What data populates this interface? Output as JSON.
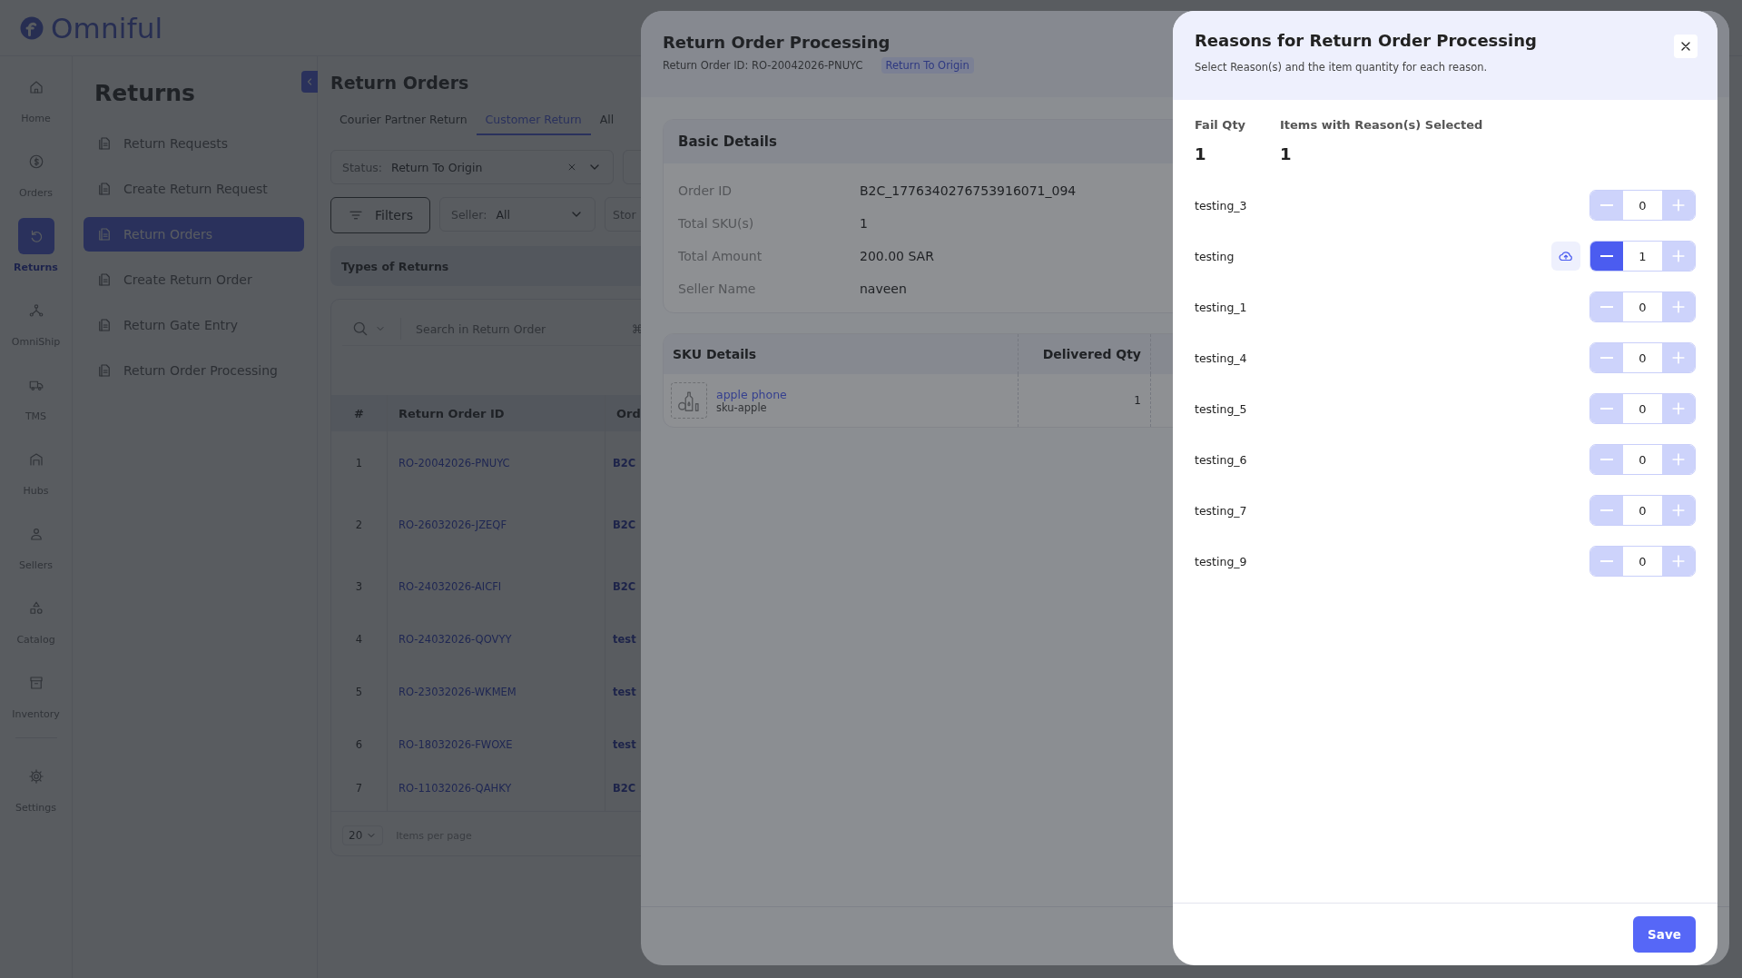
{
  "logo": {
    "text": "Omniful"
  },
  "nav": {
    "items": [
      {
        "label": "Home",
        "selected": false
      },
      {
        "label": "Orders",
        "selected": false
      },
      {
        "label": "Returns",
        "selected": true
      },
      {
        "label": "OmniShip",
        "selected": false
      },
      {
        "label": "TMS",
        "selected": false
      },
      {
        "label": "Hubs",
        "selected": false
      },
      {
        "label": "Sellers",
        "selected": false
      },
      {
        "label": "Catalog",
        "selected": false
      },
      {
        "label": "Inventory",
        "selected": false
      }
    ],
    "footer_items": [
      {
        "label": "Settings",
        "selected": false
      }
    ]
  },
  "section_menu": {
    "title": "Returns",
    "items": [
      {
        "label": "Return Requests",
        "selected": false
      },
      {
        "label": "Create Return Request",
        "selected": false
      },
      {
        "label": "Return Orders",
        "selected": true
      },
      {
        "label": "Create Return Order",
        "selected": false
      },
      {
        "label": "Return Gate Entry",
        "selected": false
      },
      {
        "label": "Return Order Processing",
        "selected": false
      }
    ]
  },
  "orders_list": {
    "title": "Return Orders",
    "tabs": [
      {
        "label": "Courier Partner Return",
        "selected": false
      },
      {
        "label": "Customer Return",
        "selected": true
      },
      {
        "label": "All",
        "selected": false
      }
    ],
    "status_filter": {
      "label": "Status:",
      "value": "Return To Origin"
    },
    "filters_button": "Filters",
    "seller_filter": {
      "label": "Seller:",
      "value": "All"
    },
    "store_filter": {
      "label": "Stor"
    },
    "types_heading": "Types of Returns",
    "search": {
      "placeholder": "Search in Return Order",
      "shortcut": "⌘"
    },
    "table": {
      "columns": [
        "#",
        "Return Order ID",
        "Ord"
      ],
      "rows": [
        {
          "number": "1",
          "return_order_id": "RO-20042026-PNUYC",
          "column_3": "B2C"
        },
        {
          "number": "2",
          "return_order_id": "RO-26032026-JZEQF",
          "column_3": "B2C"
        },
        {
          "number": "3",
          "return_order_id": "RO-24032026-AICFI",
          "column_3": "B2C"
        },
        {
          "number": "4",
          "return_order_id": "RO-24032026-QOVYY",
          "column_3": "test"
        },
        {
          "number": "5",
          "return_order_id": "RO-23032026-WKMEM",
          "column_3": "test"
        },
        {
          "number": "6",
          "return_order_id": "RO-18032026-FWOXE",
          "column_3": "test"
        },
        {
          "number": "7",
          "return_order_id": "RO-11032026-QAHKY",
          "column_3": "B2C"
        }
      ]
    },
    "pagination": {
      "per_page": "20",
      "label": "Items per page"
    }
  },
  "order_modal": {
    "title": "Return Order Processing",
    "subtitle": "Return Order ID: RO-20042026-PNUYC",
    "status_badge": "Return To Origin",
    "basic_details": {
      "title": "Basic Details",
      "fields": [
        {
          "label": "Order ID",
          "value": "B2C_1776340276753916071_094"
        },
        {
          "label": "Total SKU(s)",
          "value": "1"
        },
        {
          "label": "Total Amount",
          "value": "200.00 SAR"
        },
        {
          "label": "Seller Name",
          "value": "naveen"
        }
      ]
    },
    "sku_table": {
      "columns": [
        "SKU Details",
        "Delivered Qty"
      ],
      "rows": [
        {
          "name": "apple phone",
          "sku": "sku-apple",
          "delivered_qty": "1"
        }
      ]
    }
  },
  "reasons_panel": {
    "title": "Reasons for Return Order Processing",
    "subtitle": "Select Reason(s) and the item quantity for each reason.",
    "summary": [
      {
        "label": "Fail Qty",
        "value": "1"
      },
      {
        "label": "Items with Reason(s) Selected",
        "value": "1"
      }
    ],
    "reasons": [
      {
        "name": "testing_3",
        "quantity": "0",
        "selected": false
      },
      {
        "name": "testing",
        "quantity": "1",
        "selected": true
      },
      {
        "name": "testing_1",
        "quantity": "0",
        "selected": false
      },
      {
        "name": "testing_4",
        "quantity": "0",
        "selected": false
      },
      {
        "name": "testing_5",
        "quantity": "0",
        "selected": false
      },
      {
        "name": "testing_6",
        "quantity": "0",
        "selected": false
      },
      {
        "name": "testing_7",
        "quantity": "0",
        "selected": false
      },
      {
        "name": "testing_9",
        "quantity": "0",
        "selected": false
      }
    ],
    "save_button": "Save"
  }
}
